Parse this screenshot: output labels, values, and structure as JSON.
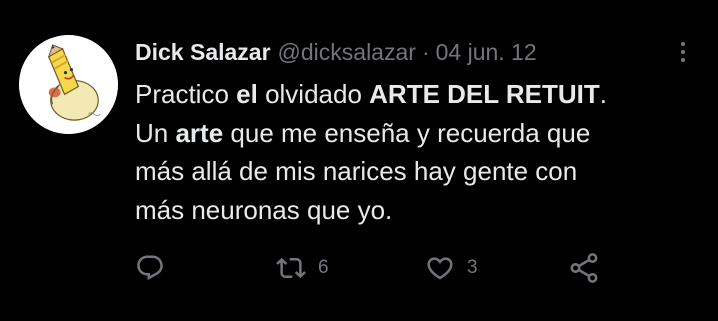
{
  "tweet": {
    "author_name": "Dick Salazar",
    "handle": "@dicksalazar",
    "separator": "·",
    "date": "04 jun. 12",
    "avatar_icon": "pencil-character-avatar",
    "more_icon": "more-vertical-icon",
    "text_lines": [
      [
        {
          "text": "Practico ",
          "bold": false
        },
        {
          "text": "el",
          "bold": true
        },
        {
          "text": " olvidado ",
          "bold": false
        },
        {
          "text": "ARTE DEL RETUIT",
          "bold": true
        },
        {
          "text": ".",
          "bold": false
        }
      ],
      [
        {
          "text": "Un ",
          "bold": false
        },
        {
          "text": "arte",
          "bold": true
        },
        {
          "text": " que me enseña y recuerda que",
          "bold": false
        }
      ],
      [
        {
          "text": "más allá de mis narices hay gente con",
          "bold": false
        }
      ],
      [
        {
          "text": "más neuronas que yo.",
          "bold": false
        }
      ]
    ],
    "actions": {
      "reply": {
        "icon": "reply-icon",
        "count": ""
      },
      "retweet": {
        "icon": "retweet-icon",
        "count": "6"
      },
      "like": {
        "icon": "heart-icon",
        "count": "3"
      },
      "share": {
        "icon": "share-icon",
        "count": ""
      }
    },
    "colors": {
      "background": "#000000",
      "primary_text": "#e7e9ea",
      "secondary_text": "#71767b"
    }
  }
}
